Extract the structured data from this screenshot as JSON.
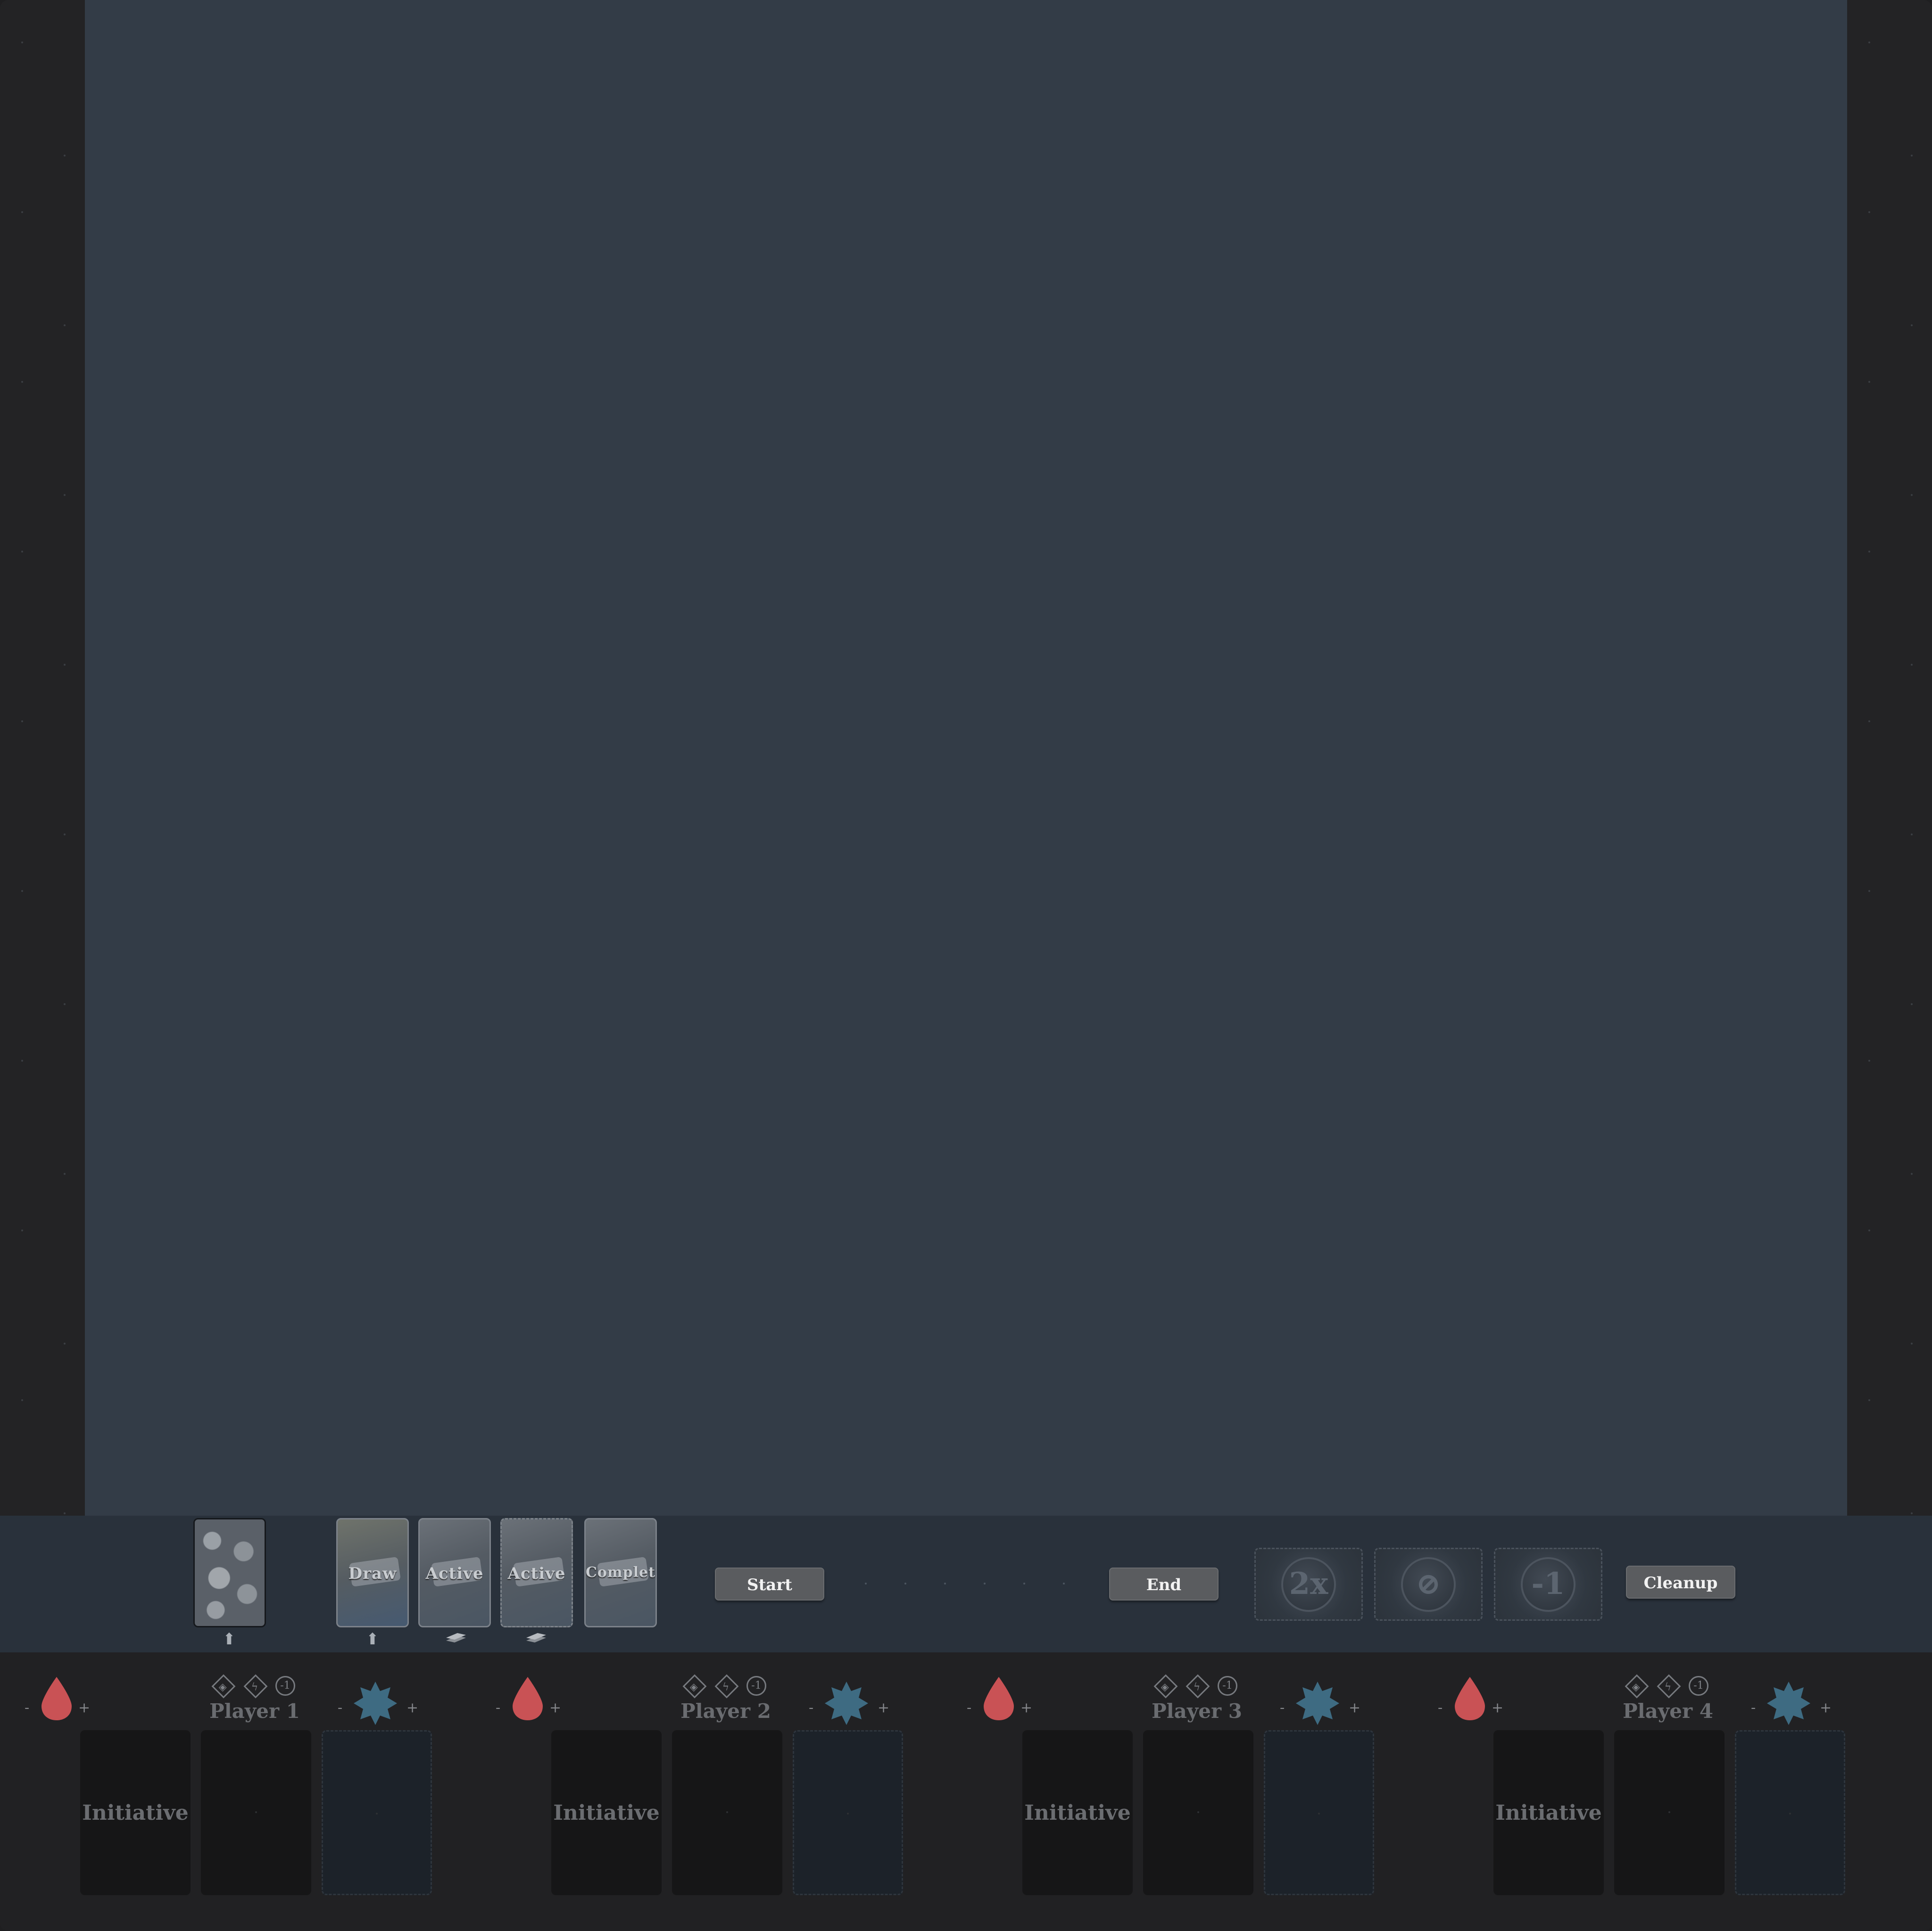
{
  "deck_tray": {
    "monster_deck": {
      "icon": "stone-wall-card"
    },
    "piles": [
      {
        "label": "Draw",
        "below_icon": "arrow-up-icon"
      },
      {
        "label": "Active",
        "below_icon": "card-stack-icon"
      },
      {
        "label": "Active",
        "below_icon": "card-stack-icon"
      },
      {
        "label": "Completed",
        "below_icon": ""
      }
    ],
    "buttons": {
      "start": "Start",
      "end": "End",
      "cleanup": "Cleanup"
    },
    "modifiers": [
      {
        "symbol": "2x",
        "icon": "double-modifier-icon"
      },
      {
        "symbol": "⊘",
        "icon": "null-modifier-icon"
      },
      {
        "symbol": "-1",
        "icon": "minus-one-modifier-icon"
      }
    ]
  },
  "players": [
    {
      "name": "Player 1",
      "minus": "-",
      "plus": "+",
      "initiative": "Initiative",
      "status_icons": [
        "◈",
        "ϟ",
        "-1"
      ]
    },
    {
      "name": "Player 2",
      "minus": "-",
      "plus": "+",
      "initiative": "Initiative",
      "status_icons": [
        "◈",
        "ϟ",
        "-1"
      ]
    },
    {
      "name": "Player 3",
      "minus": "-",
      "plus": "+",
      "initiative": "Initiative",
      "status_icons": [
        "◈",
        "ϟ",
        "-1"
      ]
    },
    {
      "name": "Player 4",
      "minus": "-",
      "plus": "+",
      "initiative": "Initiative",
      "status_icons": [
        "◈",
        "ϟ",
        "-1"
      ]
    }
  ],
  "colors": {
    "board": "#333c47",
    "health": "#c95255",
    "xp": "#3e6b82",
    "tray": "#29313b"
  }
}
